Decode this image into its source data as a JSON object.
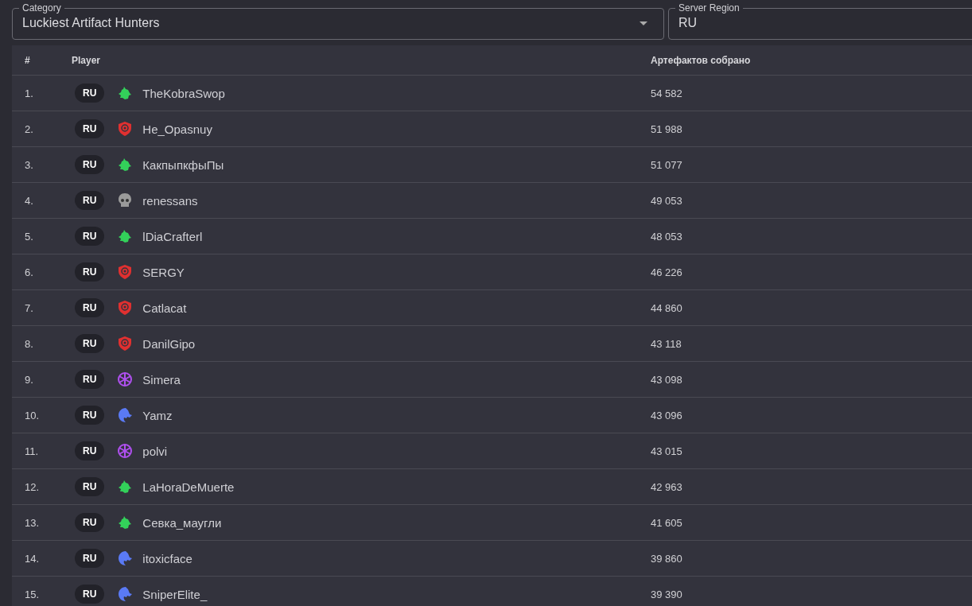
{
  "filters": [
    {
      "label": "Category",
      "value": "Luckiest Artifact Hunters"
    },
    {
      "label": "Server Region",
      "value": "RU"
    }
  ],
  "table": {
    "columns": [
      "#",
      "Player",
      "Артефактов собрано"
    ],
    "rows": [
      {
        "rank": "1.",
        "region": "RU",
        "kind": "dragon",
        "name": "TheKobraSwop",
        "score": "54 582"
      },
      {
        "rank": "2.",
        "region": "RU",
        "kind": "shield",
        "name": "He_Opasnuy",
        "score": "51 988"
      },
      {
        "rank": "3.",
        "region": "RU",
        "kind": "dragon",
        "name": "КакпыпкфыПы",
        "score": "51 077"
      },
      {
        "rank": "4.",
        "region": "RU",
        "kind": "skull",
        "name": "renessans",
        "score": "49 053"
      },
      {
        "rank": "5.",
        "region": "RU",
        "kind": "dragon",
        "name": "lDiaCrafterl",
        "score": "48 053"
      },
      {
        "rank": "6.",
        "region": "RU",
        "kind": "shield",
        "name": "SERGY",
        "score": "46 226"
      },
      {
        "rank": "7.",
        "region": "RU",
        "kind": "shield",
        "name": "Catlacat",
        "score": "44 860"
      },
      {
        "rank": "8.",
        "region": "RU",
        "kind": "shield",
        "name": "DanilGipo",
        "score": "43 118"
      },
      {
        "rank": "9.",
        "region": "RU",
        "kind": "wheel",
        "name": "Simera",
        "score": "43 098"
      },
      {
        "rank": "10.",
        "region": "RU",
        "kind": "eagle",
        "name": "Yamz",
        "score": "43 096"
      },
      {
        "rank": "11.",
        "region": "RU",
        "kind": "wheel",
        "name": "polvi",
        "score": "43 015"
      },
      {
        "rank": "12.",
        "region": "RU",
        "kind": "dragon",
        "name": "LaHoraDeMuerte",
        "score": "42 963"
      },
      {
        "rank": "13.",
        "region": "RU",
        "kind": "dragon",
        "name": "Севка_маугли",
        "score": "41 605"
      },
      {
        "rank": "14.",
        "region": "RU",
        "kind": "eagle",
        "name": "itoxicface",
        "score": "39 860"
      },
      {
        "rank": "15.",
        "region": "RU",
        "kind": "eagle",
        "name": "SniperElite_",
        "score": "39 390"
      }
    ]
  }
}
